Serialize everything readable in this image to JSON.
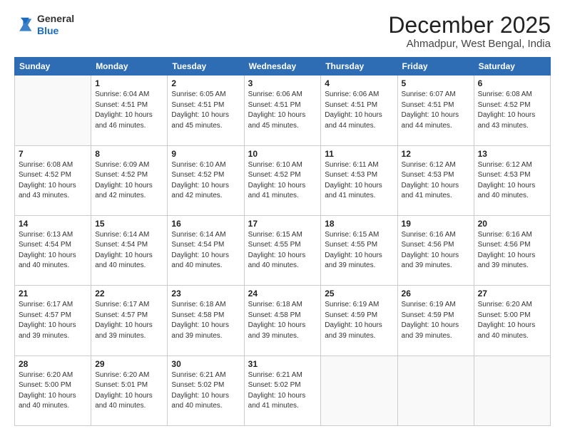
{
  "header": {
    "logo_general": "General",
    "logo_blue": "Blue",
    "month_title": "December 2025",
    "location": "Ahmadpur, West Bengal, India"
  },
  "weekdays": [
    "Sunday",
    "Monday",
    "Tuesday",
    "Wednesday",
    "Thursday",
    "Friday",
    "Saturday"
  ],
  "weeks": [
    [
      {
        "day": "",
        "sunrise": "",
        "sunset": "",
        "daylight": ""
      },
      {
        "day": "1",
        "sunrise": "6:04 AM",
        "sunset": "4:51 PM",
        "daylight": "10 hours and 46 minutes."
      },
      {
        "day": "2",
        "sunrise": "6:05 AM",
        "sunset": "4:51 PM",
        "daylight": "10 hours and 45 minutes."
      },
      {
        "day": "3",
        "sunrise": "6:06 AM",
        "sunset": "4:51 PM",
        "daylight": "10 hours and 45 minutes."
      },
      {
        "day": "4",
        "sunrise": "6:06 AM",
        "sunset": "4:51 PM",
        "daylight": "10 hours and 44 minutes."
      },
      {
        "day": "5",
        "sunrise": "6:07 AM",
        "sunset": "4:51 PM",
        "daylight": "10 hours and 44 minutes."
      },
      {
        "day": "6",
        "sunrise": "6:08 AM",
        "sunset": "4:52 PM",
        "daylight": "10 hours and 43 minutes."
      }
    ],
    [
      {
        "day": "7",
        "sunrise": "6:08 AM",
        "sunset": "4:52 PM",
        "daylight": "10 hours and 43 minutes."
      },
      {
        "day": "8",
        "sunrise": "6:09 AM",
        "sunset": "4:52 PM",
        "daylight": "10 hours and 42 minutes."
      },
      {
        "day": "9",
        "sunrise": "6:10 AM",
        "sunset": "4:52 PM",
        "daylight": "10 hours and 42 minutes."
      },
      {
        "day": "10",
        "sunrise": "6:10 AM",
        "sunset": "4:52 PM",
        "daylight": "10 hours and 41 minutes."
      },
      {
        "day": "11",
        "sunrise": "6:11 AM",
        "sunset": "4:53 PM",
        "daylight": "10 hours and 41 minutes."
      },
      {
        "day": "12",
        "sunrise": "6:12 AM",
        "sunset": "4:53 PM",
        "daylight": "10 hours and 41 minutes."
      },
      {
        "day": "13",
        "sunrise": "6:12 AM",
        "sunset": "4:53 PM",
        "daylight": "10 hours and 40 minutes."
      }
    ],
    [
      {
        "day": "14",
        "sunrise": "6:13 AM",
        "sunset": "4:54 PM",
        "daylight": "10 hours and 40 minutes."
      },
      {
        "day": "15",
        "sunrise": "6:14 AM",
        "sunset": "4:54 PM",
        "daylight": "10 hours and 40 minutes."
      },
      {
        "day": "16",
        "sunrise": "6:14 AM",
        "sunset": "4:54 PM",
        "daylight": "10 hours and 40 minutes."
      },
      {
        "day": "17",
        "sunrise": "6:15 AM",
        "sunset": "4:55 PM",
        "daylight": "10 hours and 40 minutes."
      },
      {
        "day": "18",
        "sunrise": "6:15 AM",
        "sunset": "4:55 PM",
        "daylight": "10 hours and 39 minutes."
      },
      {
        "day": "19",
        "sunrise": "6:16 AM",
        "sunset": "4:56 PM",
        "daylight": "10 hours and 39 minutes."
      },
      {
        "day": "20",
        "sunrise": "6:16 AM",
        "sunset": "4:56 PM",
        "daylight": "10 hours and 39 minutes."
      }
    ],
    [
      {
        "day": "21",
        "sunrise": "6:17 AM",
        "sunset": "4:57 PM",
        "daylight": "10 hours and 39 minutes."
      },
      {
        "day": "22",
        "sunrise": "6:17 AM",
        "sunset": "4:57 PM",
        "daylight": "10 hours and 39 minutes."
      },
      {
        "day": "23",
        "sunrise": "6:18 AM",
        "sunset": "4:58 PM",
        "daylight": "10 hours and 39 minutes."
      },
      {
        "day": "24",
        "sunrise": "6:18 AM",
        "sunset": "4:58 PM",
        "daylight": "10 hours and 39 minutes."
      },
      {
        "day": "25",
        "sunrise": "6:19 AM",
        "sunset": "4:59 PM",
        "daylight": "10 hours and 39 minutes."
      },
      {
        "day": "26",
        "sunrise": "6:19 AM",
        "sunset": "4:59 PM",
        "daylight": "10 hours and 39 minutes."
      },
      {
        "day": "27",
        "sunrise": "6:20 AM",
        "sunset": "5:00 PM",
        "daylight": "10 hours and 40 minutes."
      }
    ],
    [
      {
        "day": "28",
        "sunrise": "6:20 AM",
        "sunset": "5:00 PM",
        "daylight": "10 hours and 40 minutes."
      },
      {
        "day": "29",
        "sunrise": "6:20 AM",
        "sunset": "5:01 PM",
        "daylight": "10 hours and 40 minutes."
      },
      {
        "day": "30",
        "sunrise": "6:21 AM",
        "sunset": "5:02 PM",
        "daylight": "10 hours and 40 minutes."
      },
      {
        "day": "31",
        "sunrise": "6:21 AM",
        "sunset": "5:02 PM",
        "daylight": "10 hours and 41 minutes."
      },
      {
        "day": "",
        "sunrise": "",
        "sunset": "",
        "daylight": ""
      },
      {
        "day": "",
        "sunrise": "",
        "sunset": "",
        "daylight": ""
      },
      {
        "day": "",
        "sunrise": "",
        "sunset": "",
        "daylight": ""
      }
    ]
  ]
}
